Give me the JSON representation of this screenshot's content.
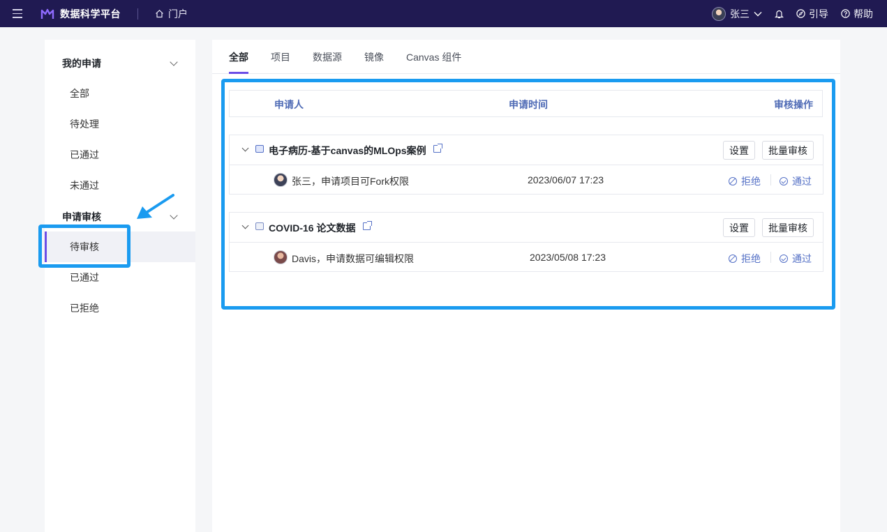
{
  "topbar": {
    "brand": "数据科学平台",
    "portal": "门户",
    "user_name": "张三",
    "guide": "引导",
    "help": "帮助"
  },
  "sidebar": {
    "group1_title": "我的申请",
    "group1_items": [
      "全部",
      "待处理",
      "已通过",
      "未通过"
    ],
    "group2_title": "申请审核",
    "group2_items": [
      "待审核",
      "已通过",
      "已拒绝"
    ],
    "active_item": "待审核"
  },
  "tabs": [
    "全部",
    "项目",
    "数据源",
    "镜像",
    "Canvas 组件"
  ],
  "active_tab": "全部",
  "table": {
    "col_applicant": "申请人",
    "col_time": "申请时间",
    "col_actions": "审核操作"
  },
  "cards": [
    {
      "name": "电子病历-基于canvas的MLOps案例",
      "settings_label": "设置",
      "batch_label": "批量审核",
      "request": "张三，申请项目可Fork权限",
      "time": "2023/06/07 17:23",
      "reject_label": "拒绝",
      "approve_label": "通过"
    },
    {
      "name": "COVID-16 论文数据",
      "settings_label": "设置",
      "batch_label": "批量审核",
      "request": "Davis，申请数据可编辑权限",
      "time": "2023/05/08 17:23",
      "reject_label": "拒绝",
      "approve_label": "通过"
    }
  ],
  "colors": {
    "topbar_bg": "#201a52",
    "accent": "#6b4de6",
    "link": "#5470c6",
    "highlight": "#1a9bf0"
  }
}
